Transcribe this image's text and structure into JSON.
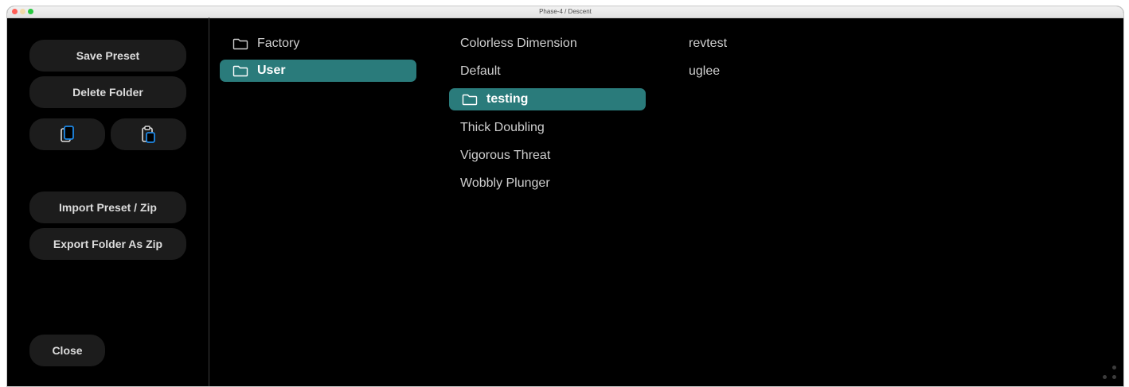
{
  "window": {
    "title": "Phase-4 / Descent"
  },
  "sidebar": {
    "save_preset": "Save Preset",
    "delete_folder": "Delete Folder",
    "import_preset": "Import Preset / Zip",
    "export_folder": "Export Folder As Zip",
    "close": "Close",
    "copy_icon": "copy-icon",
    "paste_icon": "paste-icon"
  },
  "columns": {
    "root": [
      {
        "label": "Factory",
        "type": "folder",
        "selected": false
      },
      {
        "label": "User",
        "type": "folder",
        "selected": true
      }
    ],
    "user": [
      {
        "label": "Colorless Dimension",
        "type": "preset",
        "selected": false
      },
      {
        "label": "Default",
        "type": "preset",
        "selected": false
      },
      {
        "label": "testing",
        "type": "folder",
        "selected": true
      },
      {
        "label": "Thick Doubling",
        "type": "preset",
        "selected": false
      },
      {
        "label": "Vigorous Threat",
        "type": "preset",
        "selected": false
      },
      {
        "label": "Wobbly Plunger",
        "type": "preset",
        "selected": false
      }
    ],
    "testing": [
      {
        "label": "revtest",
        "type": "preset",
        "selected": false
      },
      {
        "label": "uglee",
        "type": "preset",
        "selected": false
      }
    ]
  },
  "colors": {
    "selection": "#2a7b7b",
    "background": "#000000",
    "button": "#1c1c1c",
    "icon_accent": "#1e88e5"
  }
}
